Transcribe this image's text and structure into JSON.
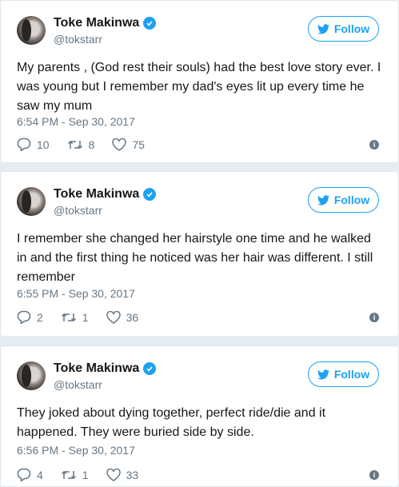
{
  "colors": {
    "accent": "#1da1f2",
    "muted": "#657786",
    "text": "#14171a",
    "background": "#e6ecf0"
  },
  "tweets": [
    {
      "name": "Toke Makinwa",
      "handle": "@tokstarr",
      "follow_label": "Follow",
      "text": "My parents , (God rest their souls) had the best love story ever. I was young but I remember my dad's eyes lit up every time he saw my mum",
      "time": "6:54 PM - Sep 30, 2017",
      "replies": "10",
      "retweets": "8",
      "likes": "75"
    },
    {
      "name": "Toke Makinwa",
      "handle": "@tokstarr",
      "follow_label": "Follow",
      "text": "I remember she changed her hairstyle one time and he walked in and the first thing he noticed was her hair was different. I still remember",
      "time": "6:55 PM - Sep 30, 2017",
      "replies": "2",
      "retweets": "1",
      "likes": "36"
    },
    {
      "name": "Toke Makinwa",
      "handle": "@tokstarr",
      "follow_label": "Follow",
      "text": "They joked about dying together, perfect ride/die and it happened. They were buried side by side.",
      "time": "6:56 PM - Sep 30, 2017",
      "replies": "4",
      "retweets": "1",
      "likes": "33"
    }
  ]
}
